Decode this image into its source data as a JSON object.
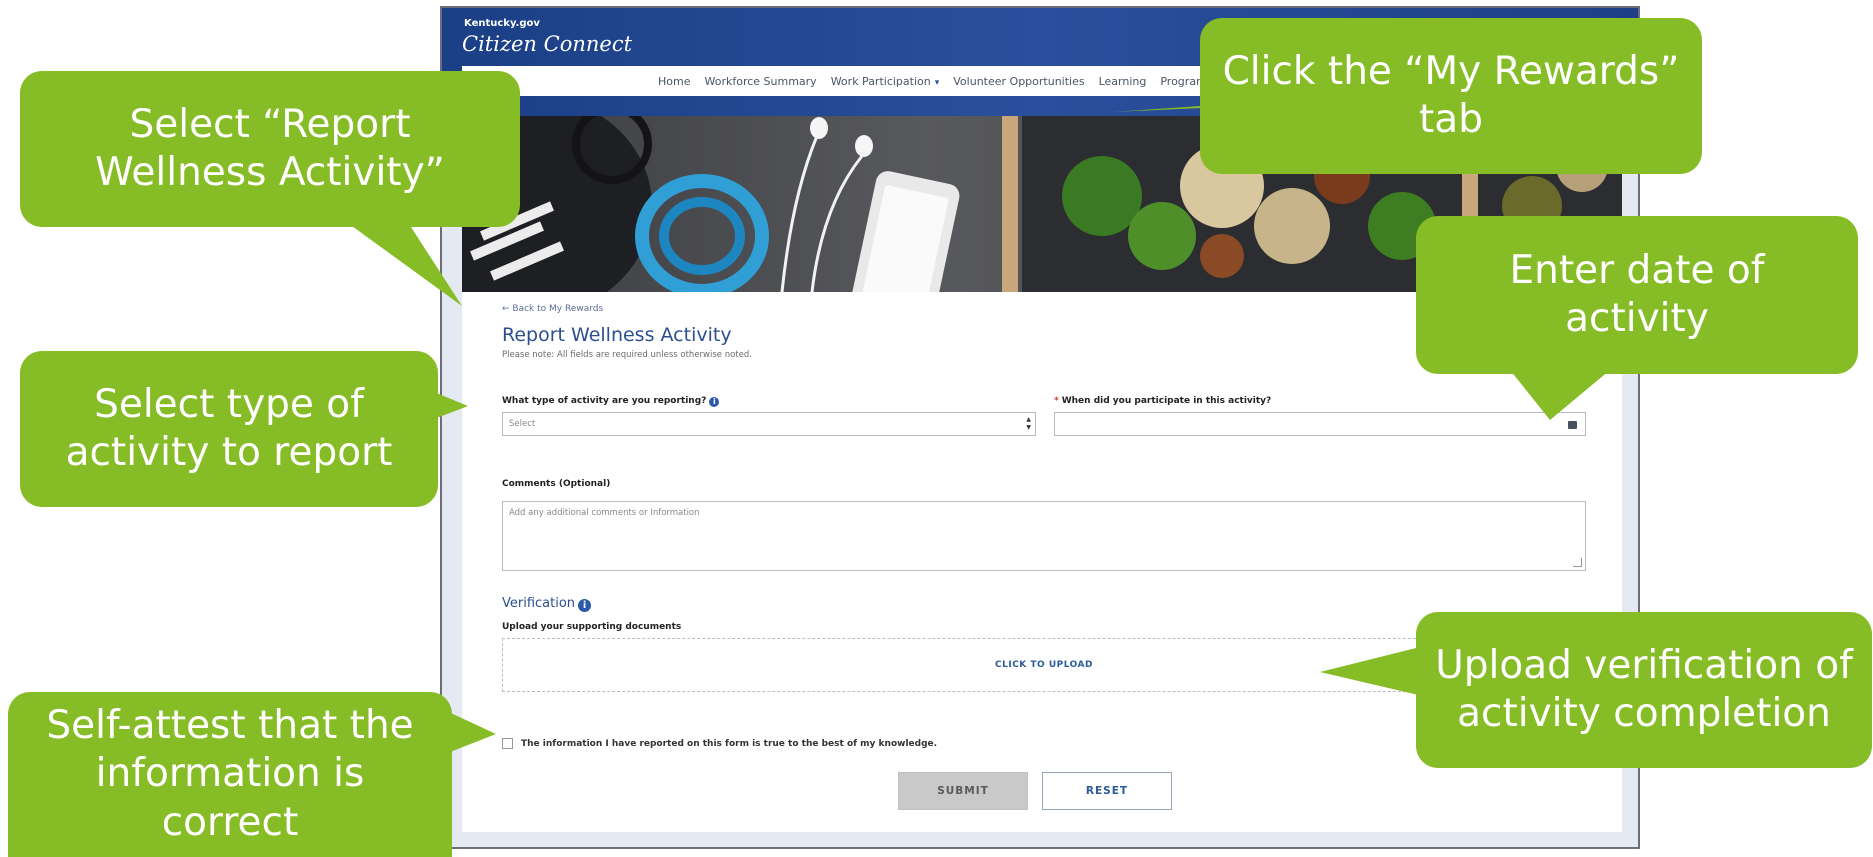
{
  "header": {
    "brand_top": "Kentucky.gov",
    "brand_main": "Citizen Connect"
  },
  "nav": {
    "items": [
      "Home",
      "Workforce Summary",
      "Work Participation",
      "Volunteer Opportunities",
      "Learning",
      "Program"
    ],
    "dropdown_caret": "▾"
  },
  "form": {
    "back_link": "← Back to My Rewards",
    "title": "Report Wellness Activity",
    "note": "Please note: All fields are required unless otherwise noted.",
    "activity_type_label": "What type of activity are you reporting?",
    "activity_type_placeholder": "Select",
    "date_required_mark": "*",
    "date_label": "When did you participate in this activity?",
    "comments_label": "Comments (Optional)",
    "comments_placeholder": "Add any additional comments or Information",
    "verification_title": "Verification",
    "upload_label": "Upload your supporting documents",
    "upload_button": "CLICK TO UPLOAD",
    "attest_text": "The information I have reported on this form is true to the best of my knowledge.",
    "submit_label": "SUBMIT",
    "reset_label": "RESET"
  },
  "callouts": {
    "report_wellness": "Select “Report Wellness Activity”",
    "my_rewards": "Click the “My Rewards” tab",
    "enter_date": "Enter date of activity",
    "select_type": "Select type of activity to report",
    "upload_verification": "Upload verification of activity completion",
    "self_attest": "Self-attest that the information is correct"
  },
  "colors": {
    "callout_green": "#86bc25",
    "header_blue": "#1b3f86",
    "title_blue": "#2b4f8f"
  }
}
